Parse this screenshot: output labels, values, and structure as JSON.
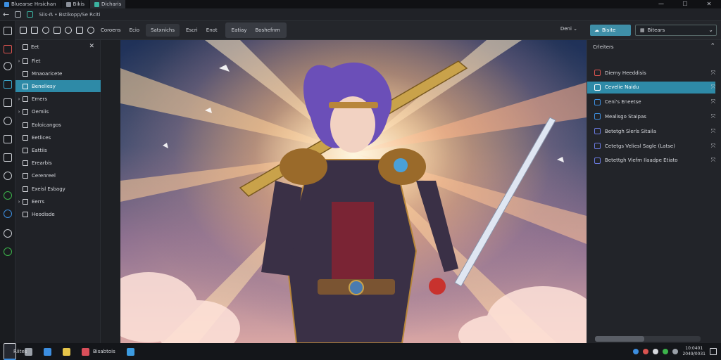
{
  "tabs": [
    {
      "label": "Bluearse Hrsichan",
      "active": false
    },
    {
      "label": "Bikis",
      "active": false
    },
    {
      "label": "Dicharis",
      "active": true
    }
  ],
  "window_controls": {
    "minimize": "—",
    "maximize": "☐",
    "close": "✕"
  },
  "address": {
    "text": "Siis-ẞ • Bstikopp/Se   Rciti"
  },
  "toolbar": {
    "buttons": [
      "Coroens",
      "Ecio",
      "Satxnichs",
      "Escri",
      "Enot"
    ],
    "group": [
      "Eatiay",
      "Boshefnm"
    ],
    "dropdown": "Deni",
    "primary": "Bisite",
    "select": "Bitears"
  },
  "explorer": {
    "title": "Eet",
    "items": [
      {
        "label": "Fiet",
        "chevron": true
      },
      {
        "label": "Mnaoaricete",
        "chevron": false
      },
      {
        "label": "Beneliesy",
        "chevron": false,
        "selected": true
      },
      {
        "label": "Emers",
        "chevron": true
      },
      {
        "label": "Oemiis",
        "chevron": true
      },
      {
        "label": "Eoloicangos",
        "chevron": false
      },
      {
        "label": "Eetlices",
        "chevron": false
      },
      {
        "label": "Eattiis",
        "chevron": false
      },
      {
        "label": "Erearbis",
        "chevron": false
      },
      {
        "label": "Cerenreel",
        "chevron": false
      },
      {
        "label": "Exeisl Esbagy",
        "chevron": false
      },
      {
        "label": "Eerrs",
        "chevron": true
      },
      {
        "label": "Heodisde",
        "chevron": false
      }
    ]
  },
  "right_panel": {
    "title": "Crleiters",
    "items": [
      {
        "label": "Diemy Heeddisis",
        "color": "#d9534f",
        "selected": false
      },
      {
        "label": "Cevelie Naidu",
        "color": "#ffffff",
        "selected": true
      },
      {
        "label": "Ceni's Eneetse",
        "color": "#3c8ee0",
        "selected": false
      },
      {
        "label": "Mealisgo Staipas",
        "color": "#3c8ee0",
        "selected": false
      },
      {
        "label": "Betetgh Slerls Sitaila",
        "color": "#6a7ae0",
        "selected": false
      },
      {
        "label": "Cetetgs Veliesl Sagle (Latse)",
        "color": "#6a7ae0",
        "selected": false
      },
      {
        "label": "Betettgh Viefm Ilaadpe Etiato",
        "color": "#6a7ae0",
        "selected": false
      }
    ]
  },
  "taskbar": {
    "apps": [
      {
        "label": "",
        "color": "#ffffff"
      },
      {
        "label": "",
        "color": "#9aa0a8"
      },
      {
        "label": "",
        "color": "#3c8ee0"
      },
      {
        "label": "",
        "color": "#e6c54a"
      },
      {
        "label": "Bisabtois",
        "color": "#d94f5a"
      },
      {
        "label": "Riites",
        "color": "#3c8ee0",
        "active": true
      },
      {
        "label": "",
        "color": "#3c9be0"
      }
    ],
    "clock_line1": "10:0401",
    "clock_line2": "2049/0031"
  }
}
